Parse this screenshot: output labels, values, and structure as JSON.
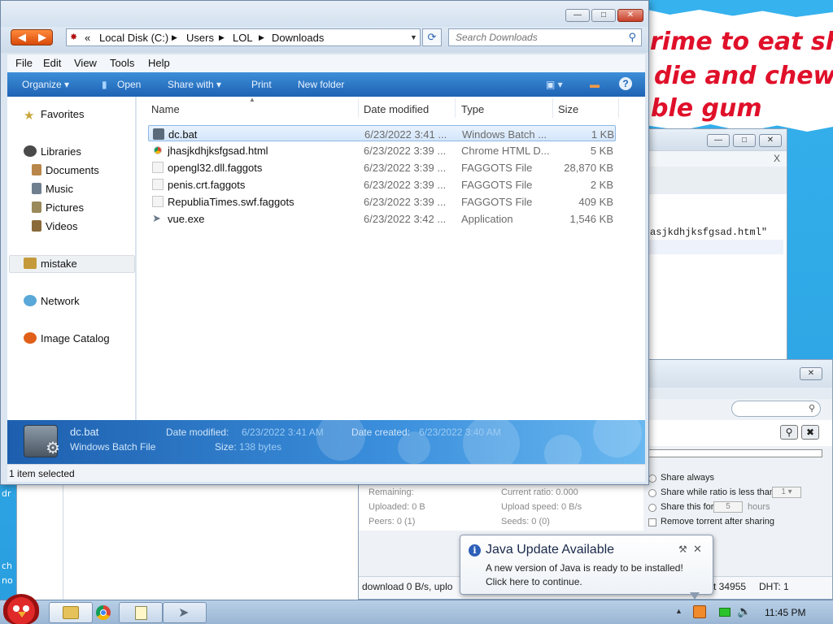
{
  "desktop": {
    "left_fragments": [
      "dr",
      "ch",
      "no"
    ],
    "banner_lines": [
      "rime to eat shit",
      "die and chew",
      "ble gum"
    ]
  },
  "bg_windows": {
    "cmd_text": "asjkdhjksfgsad.html\"",
    "close_x": "X",
    "torrent": {
      "share_always": "Share always",
      "share_ratio": "Share while ratio is less than",
      "ratio_value": "1",
      "share_for": "Share this for",
      "hours_value": "5",
      "hours": "hours",
      "remove": "Remove torrent after sharing",
      "remaining": "Remaining:",
      "uploaded": "Uploaded: 0 B",
      "peers": "Peers: 0  (1)",
      "ratio": "Current ratio: 0.000",
      "upload_speed": "Upload speed: 0 B/s",
      "seeds": "Seeds: 0  (0)",
      "status_left": "download 0 B/s, uplo",
      "status_port": "t 34955",
      "status_dht": "DHT: 1"
    }
  },
  "explorer": {
    "address": {
      "chevron": "«",
      "segments": [
        "Local Disk (C:)",
        "Users",
        "LOL",
        "Downloads"
      ]
    },
    "search_placeholder": "Search Downloads",
    "menu": [
      "File",
      "Edit",
      "View",
      "Tools",
      "Help"
    ],
    "commands": [
      "Organize",
      "Open",
      "Share with",
      "Print",
      "New folder"
    ],
    "nav": {
      "favorites": "Favorites",
      "libraries": "Libraries",
      "documents": "Documents",
      "music": "Music",
      "pictures": "Pictures",
      "videos": "Videos",
      "mistake": "mistake",
      "network": "Network",
      "image_catalog": "Image Catalog"
    },
    "columns": [
      "Name",
      "Date modified",
      "Type",
      "Size"
    ],
    "files": [
      {
        "name": "dc.bat",
        "date": "6/23/2022 3:41 ...",
        "type": "Windows Batch ...",
        "size": "1 KB"
      },
      {
        "name": "jhasjkdhjksfgsad.html",
        "date": "6/23/2022 3:39 ...",
        "type": "Chrome HTML D...",
        "size": "5 KB"
      },
      {
        "name": "opengl32.dll.faggots",
        "date": "6/23/2022 3:39 ...",
        "type": "FAGGOTS File",
        "size": "28,870 KB"
      },
      {
        "name": "penis.crt.faggots",
        "date": "6/23/2022 3:39 ...",
        "type": "FAGGOTS File",
        "size": "2 KB"
      },
      {
        "name": "RepubliaTimes.swf.faggots",
        "date": "6/23/2022 3:39 ...",
        "type": "FAGGOTS File",
        "size": "409 KB"
      },
      {
        "name": "vue.exe",
        "date": "6/23/2022 3:42 ...",
        "type": "Application",
        "size": "1,546 KB"
      }
    ],
    "details": {
      "name": "dc.bat",
      "type": "Windows Batch File",
      "date_modified_label": "Date modified:",
      "date_modified": "6/23/2022 3:41 AM",
      "date_created_label": "Date created:",
      "date_created": "6/23/2022 3:40 AM",
      "size_label": "Size:",
      "size": "138 bytes"
    },
    "status": "1 item selected"
  },
  "java_popup": {
    "title": "Java Update Available",
    "line1": "A new version of Java is ready to be installed!",
    "line2": "Click here to continue."
  },
  "taskbar": {
    "clock": "11:45 PM"
  },
  "colors": {
    "desktop": "#2fa8e6",
    "command_bar": "#1f63b4",
    "selection": "#d4e6fb",
    "banner_text": "#e0102a"
  }
}
